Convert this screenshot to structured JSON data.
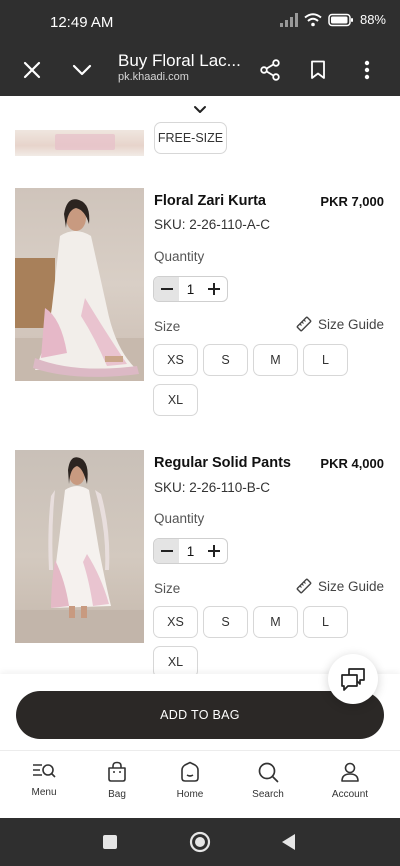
{
  "status_bar": {
    "time": "12:49 AM",
    "battery": "88%"
  },
  "browser": {
    "title": "Buy Floral Lac...",
    "url": "pk.khaadi.com",
    "icons": [
      "close-icon",
      "chevron-down-icon",
      "share-icon",
      "bookmark-icon",
      "more-vert-icon"
    ]
  },
  "top_partial": {
    "size_label": "FREE-SIZE"
  },
  "products": [
    {
      "name": "Floral Zari Kurta",
      "price": "PKR 7,000",
      "sku": "SKU: 2-26-110-A-C",
      "quantity_label": "Quantity",
      "quantity": "1",
      "size_label": "Size",
      "size_guide": "Size Guide",
      "sizes": [
        "XS",
        "S",
        "M",
        "L",
        "XL"
      ]
    },
    {
      "name": "Regular Solid Pants",
      "price": "PKR 4,000",
      "sku": "SKU: 2-26-110-B-C",
      "quantity_label": "Quantity",
      "quantity": "1",
      "size_label": "Size",
      "size_guide": "Size Guide",
      "sizes": [
        "XS",
        "S",
        "M",
        "L",
        "XL"
      ]
    }
  ],
  "add_to_bag": "ADD TO BAG",
  "bottom_nav": [
    {
      "label": "Menu",
      "icon": "menu-search-icon"
    },
    {
      "label": "Bag",
      "icon": "bag-icon"
    },
    {
      "label": "Home",
      "icon": "home-icon"
    },
    {
      "label": "Search",
      "icon": "search-icon"
    },
    {
      "label": "Account",
      "icon": "account-icon"
    }
  ],
  "system_nav": [
    "recents-icon",
    "home-circle-icon",
    "back-icon"
  ]
}
